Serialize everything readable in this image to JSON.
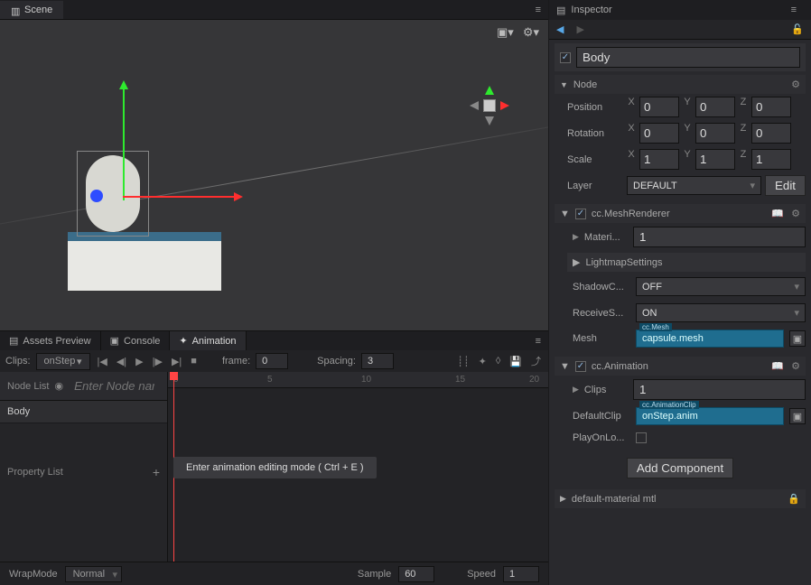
{
  "scene": {
    "tab_label": "Scene"
  },
  "bottom_tabs": {
    "assets_preview": "Assets Preview",
    "console": "Console",
    "animation": "Animation"
  },
  "anim": {
    "clips_label": "Clips:",
    "clip_selected": "onStep",
    "frame_label": "frame:",
    "frame_value": "0",
    "spacing_label": "Spacing:",
    "spacing_value": "3",
    "node_list_label": "Node List",
    "node_filter_placeholder": "Enter Node nam",
    "node_name": "Body",
    "property_list_label": "Property List",
    "hint": "Enter animation editing mode ( Ctrl + E )",
    "ruler": [
      "0",
      "5",
      "10",
      "15",
      "20"
    ],
    "wrapmode_label": "WrapMode",
    "wrapmode_value": "Normal",
    "sample_label": "Sample",
    "sample_value": "60",
    "speed_label": "Speed",
    "speed_value": "1"
  },
  "inspector": {
    "tab_label": "Inspector",
    "node_name": "Body",
    "section_node": "Node",
    "position_label": "Position",
    "rotation_label": "Rotation",
    "scale_label": "Scale",
    "layer_label": "Layer",
    "layer_value": "DEFAULT",
    "edit_btn": "Edit",
    "pos": {
      "x": "0",
      "y": "0",
      "z": "0"
    },
    "rot": {
      "x": "0",
      "y": "0",
      "z": "0"
    },
    "scl": {
      "x": "1",
      "y": "1",
      "z": "1"
    },
    "mesh_renderer": {
      "title": "cc.MeshRenderer",
      "materials_label": "Materi...",
      "materials_count": "1",
      "lightmap_label": "LightmapSettings",
      "shadow_label": "ShadowC...",
      "shadow_value": "OFF",
      "receive_label": "ReceiveS...",
      "receive_value": "ON",
      "mesh_label": "Mesh",
      "mesh_tag": "cc.Mesh",
      "mesh_value": "capsule.mesh"
    },
    "animation": {
      "title": "cc.Animation",
      "clips_label": "Clips",
      "clips_count": "1",
      "default_label": "DefaultClip",
      "default_tag": "cc.AnimationClip",
      "default_value": "onStep.anim",
      "play_label": "PlayOnLo..."
    },
    "add_component": "Add Component",
    "footer_item": "default-material mtl"
  }
}
